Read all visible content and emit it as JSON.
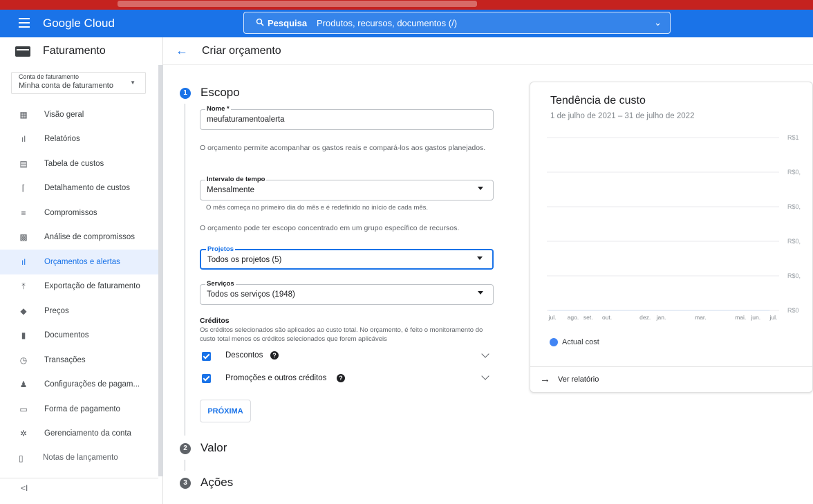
{
  "topbar": {
    "brand": "Google Cloud",
    "search_label": "Pesquisa",
    "search_placeholder": "Produtos, recursos, documentos (/)"
  },
  "sidebar": {
    "title": "Faturamento",
    "account_label": "Conta de faturamento",
    "account_value": "Minha conta de faturamento",
    "items": [
      {
        "label": "Visão geral",
        "icon": "dashboard-icon"
      },
      {
        "label": "Relatórios",
        "icon": "bar-chart-icon"
      },
      {
        "label": "Tabela de custos",
        "icon": "table-icon"
      },
      {
        "label": "Detalhamento de custos",
        "icon": "breakdown-icon"
      },
      {
        "label": "Compromissos",
        "icon": "list-icon"
      },
      {
        "label": "Análise de compromissos",
        "icon": "analysis-icon"
      },
      {
        "label": "Orçamentos e alertas",
        "icon": "budget-icon",
        "active": true
      },
      {
        "label": "Exportação de faturamento",
        "icon": "export-icon"
      },
      {
        "label": "Preços",
        "icon": "tag-icon"
      },
      {
        "label": "Documentos",
        "icon": "document-icon"
      },
      {
        "label": "Transações",
        "icon": "history-icon"
      },
      {
        "label": "Configurações de pagam...",
        "icon": "person-icon"
      },
      {
        "label": "Forma de pagamento",
        "icon": "credit-card-icon"
      },
      {
        "label": "Gerenciamento da conta",
        "icon": "gear-icon"
      }
    ],
    "release_notes": "Notas de lançamento",
    "collapse": "<I"
  },
  "header": {
    "title": "Criar orçamento"
  },
  "steps": {
    "scope": {
      "num": "1",
      "title": "Escopo"
    },
    "value": {
      "num": "2",
      "title": "Valor"
    },
    "actions": {
      "num": "3",
      "title": "Ações"
    }
  },
  "form": {
    "name_label": "Nome *",
    "name_value": "meufaturamentoalerta",
    "desc": "O orçamento permite acompanhar os gastos reais e compará-los aos gastos planejados.",
    "interval_label": "Intervalo de tempo",
    "interval_value": "Mensalmente",
    "interval_help": "O mês começa no primeiro dia do mês e é redefinido no início de cada mês.",
    "scope_help": "O orçamento pode ter escopo concentrado em um grupo específico de recursos.",
    "projects_label": "Projetos",
    "projects_value": "Todos os projetos (5)",
    "services_label": "Serviços",
    "services_value": "Todos os serviços (1948)",
    "credits_title": "Créditos",
    "credits_help": "Os créditos selecionados são aplicados ao custo total. No orçamento, é feito o monitoramento do custo total menos os créditos selecionados que forem aplicáveis",
    "discounts_label": "Descontos",
    "promotions_label": "Promoções e outros créditos",
    "next_button": "PRÓXIMA"
  },
  "chart_card": {
    "title": "Tendência de custo",
    "subtitle": "1 de julho de 2021 – 31 de julho de 2022",
    "legend": "Actual cost",
    "report_link": "Ver relatório"
  },
  "chart_data": {
    "type": "line",
    "x": [
      "jul.",
      "ago.",
      "set.",
      "out.",
      "dez.",
      "jan.",
      "mar.",
      "mai.",
      "jun.",
      "jul."
    ],
    "y_ticks": [
      "R$1",
      "R$0,",
      "R$0,",
      "R$0,",
      "R$0,",
      "R$0"
    ],
    "series": [
      {
        "name": "Actual cost",
        "values": [
          0,
          0,
          0,
          0,
          0,
          0,
          0,
          0,
          0,
          0
        ]
      }
    ],
    "grid": true,
    "legend_position": "bottom-left",
    "colors": {
      "actual": "#4285f4"
    }
  }
}
